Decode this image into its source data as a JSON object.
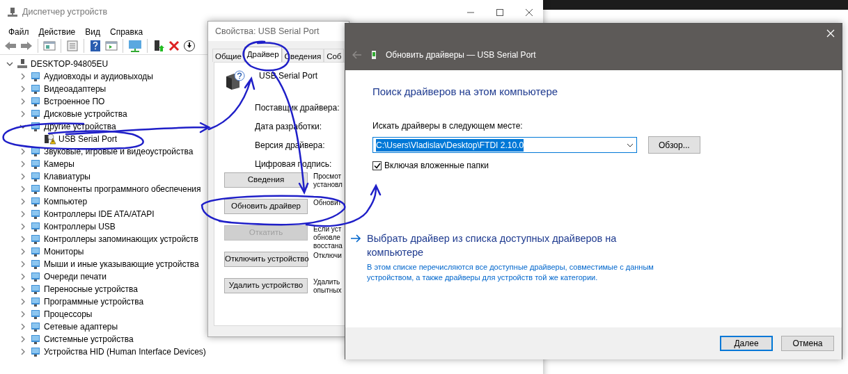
{
  "device_manager": {
    "title": "Диспетчер устройств",
    "menu": [
      "Файл",
      "Действие",
      "Вид",
      "Справка"
    ],
    "tree": {
      "label": "DESKTOP-94805EU",
      "expanded": true,
      "children": [
        {
          "label": "Аудиовходы и аудиовыходы",
          "expanded": false
        },
        {
          "label": "Видеоадаптеры",
          "expanded": false
        },
        {
          "label": "Встроенное ПО",
          "expanded": false
        },
        {
          "label": "Дисковые устройства",
          "expanded": false
        },
        {
          "label": "Другие устройства",
          "expanded": true,
          "children": [
            {
              "label": "USB Serial Port",
              "warning": true
            }
          ]
        },
        {
          "label": "Звуковые, игровые и видеоустройства",
          "expanded": false
        },
        {
          "label": "Камеры",
          "expanded": false
        },
        {
          "label": "Клавиатуры",
          "expanded": false
        },
        {
          "label": "Компоненты программного обеспечения",
          "expanded": false
        },
        {
          "label": "Компьютер",
          "expanded": false
        },
        {
          "label": "Контроллеры IDE ATA/ATAPI",
          "expanded": false
        },
        {
          "label": "Контроллеры USB",
          "expanded": false
        },
        {
          "label": "Контроллеры запоминающих устройств",
          "expanded": false
        },
        {
          "label": "Мониторы",
          "expanded": false
        },
        {
          "label": "Мыши и иные указывающие устройства",
          "expanded": false
        },
        {
          "label": "Очереди печати",
          "expanded": false
        },
        {
          "label": "Переносные устройства",
          "expanded": false
        },
        {
          "label": "Программные устройства",
          "expanded": false
        },
        {
          "label": "Процессоры",
          "expanded": false
        },
        {
          "label": "Сетевые адаптеры",
          "expanded": false
        },
        {
          "label": "Системные устройства",
          "expanded": false
        },
        {
          "label": "Устройства HID (Human Interface Devices)",
          "expanded": false
        }
      ]
    }
  },
  "properties": {
    "title": "Свойства: USB Serial Port",
    "tabs": [
      {
        "label": "Общие",
        "selected": false
      },
      {
        "label": "Драйвер",
        "selected": true
      },
      {
        "label": "Сведения",
        "selected": false
      },
      {
        "label": "Соб",
        "selected": false
      }
    ],
    "device_name": "USB Serial Port",
    "fields": [
      "Поставщик драйвера:",
      "Дата разработки:",
      "Версия драйвера:",
      "Цифровая подпись:"
    ],
    "actions": [
      {
        "button": "Сведения",
        "disabled": false,
        "description": [
          "Просмот",
          "установл"
        ]
      },
      {
        "button": "Обновить драйвер",
        "disabled": false,
        "description": [
          "Обновит"
        ]
      },
      {
        "button": "Откатить",
        "disabled": true,
        "description": [
          "Если уст",
          "обновле",
          "восстана"
        ]
      },
      {
        "button": "Отключить устройство",
        "disabled": false,
        "description": [
          "Отключи"
        ]
      },
      {
        "button": "Удалить устройство",
        "disabled": false,
        "description": [
          "Удалить",
          "опытных"
        ]
      }
    ]
  },
  "update_driver": {
    "title": "Обновить драйверы — USB Serial Port",
    "heading": "Поиск драйверов на этом компьютере",
    "location_label": "Искать драйверы в следующем месте:",
    "location_value": "C:\\Users\\Vladislav\\Desktop\\FTDI 2.10.0",
    "browse_button": "Обзор...",
    "include_subfolders": {
      "label": "Включая вложенные папки",
      "checked": true
    },
    "link": {
      "text": "Выбрать драйвер из списка доступных драйверов на компьютере",
      "description": "В этом списке перечисляются все доступные драйверы, совместимые с данным устройством, а также драйверы для устройств той же категории."
    },
    "buttons": [
      {
        "label": "Далее",
        "default": true
      },
      {
        "label": "Отмена",
        "default": false
      }
    ]
  }
}
